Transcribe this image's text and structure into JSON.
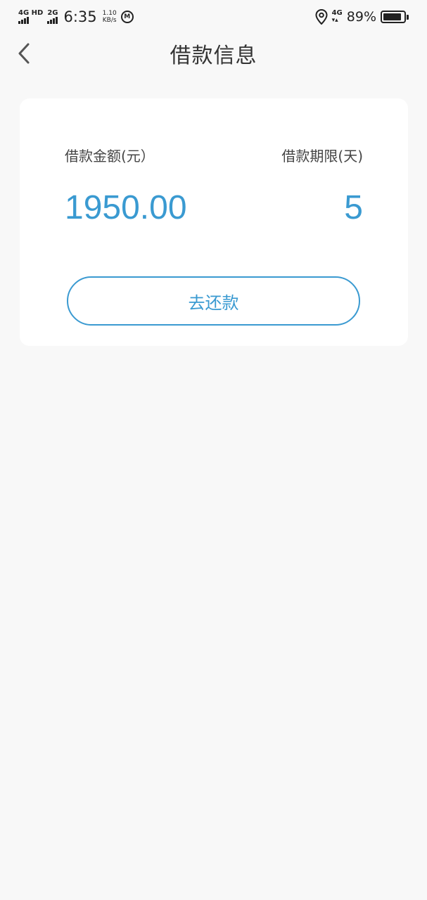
{
  "status_bar": {
    "net1": "4G HD",
    "net2": "2G",
    "time": "6:35",
    "speed_value": "1.10",
    "speed_unit": "KB/s",
    "net3": "4G",
    "battery_pct": "89%",
    "battery_level": 0.89
  },
  "header": {
    "title": "借款信息"
  },
  "loan": {
    "amount_label": "借款金额(元）",
    "term_label": "借款期限(天)",
    "amount_value": "1950.00",
    "term_value": "5",
    "repay_button": "去还款"
  },
  "colors": {
    "accent": "#3a9ad1",
    "background": "#f8f8f8"
  }
}
